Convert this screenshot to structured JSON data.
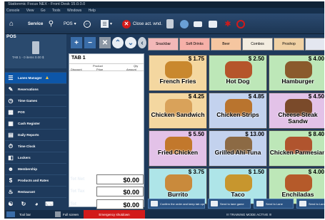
{
  "window": {
    "title": "Stationmic Focus NEX - Front Desk 15.0.0.0"
  },
  "menu": [
    "Console",
    "View",
    "Go",
    "Tools",
    "Windows",
    "Help"
  ],
  "toolbar": {
    "service_label": "Service",
    "pos_label": "POS",
    "close_act_label": "Close act. wnd."
  },
  "pos_panel": {
    "title": "POS",
    "subtitle": "TAB 1 - 0 items 0.00 $"
  },
  "sidebar": {
    "items": [
      {
        "label": "Lanes Manager",
        "icon": "lanes-icon"
      },
      {
        "label": "Reservations",
        "icon": "reservations-icon"
      },
      {
        "label": "Time Games",
        "icon": "clock-icon"
      },
      {
        "label": "POS",
        "icon": "pos-icon"
      },
      {
        "label": "Cash Register",
        "icon": "cash-register-icon"
      },
      {
        "label": "Daily Reports",
        "icon": "reports-icon"
      },
      {
        "label": "Time Clock",
        "icon": "time-clock-icon"
      },
      {
        "label": "Lockers",
        "icon": "lockers-icon"
      },
      {
        "label": "Membership",
        "icon": "membership-icon"
      },
      {
        "label": "Products and Rates",
        "icon": "products-icon"
      },
      {
        "label": "Restaurant",
        "icon": "restaurant-icon"
      }
    ]
  },
  "ticket": {
    "tab_name": "TAB 1",
    "columns": {
      "product": "Product",
      "qty": "Qty",
      "discount": "Discount",
      "price": "Price",
      "amount": "Amount"
    },
    "tot_net_label": "Tot Net",
    "tot_net": "$0.00",
    "tot_tax_label": "Tot Tax",
    "tot_tax": "$0.00",
    "tot_label": "Tot",
    "tot": "$0.00"
  },
  "categories": [
    {
      "label": "Snackbar",
      "color": "#f3b8b8"
    },
    {
      "label": "Soft Drinks",
      "color": "#f6b0a8"
    },
    {
      "label": "Beer",
      "color": "#f5c6a0"
    },
    {
      "label": "Combos",
      "color": "#f3ede0"
    },
    {
      "label": "Proshop",
      "color": "#f0d1a4"
    },
    {
      "label": "",
      "color": "#e4e7f0"
    }
  ],
  "products": [
    {
      "name": "French Fries",
      "price": "$ 1.75",
      "color": "#f4d7a0"
    },
    {
      "name": "Hot Dog",
      "price": "$ 2.50",
      "color": "#bde7b8"
    },
    {
      "name": "Hamburger",
      "price": "$ 4.00",
      "color": "#bde7b8"
    },
    {
      "name": "Chicken Sandwich",
      "price": "$ 4.25",
      "color": "#f4d7a0"
    },
    {
      "name": "Chicken Strips",
      "price": "$ 4.85",
      "color": "#c3d2ee"
    },
    {
      "name": "Cheese Steak Sandw",
      "price": "$ 4.50",
      "color": "#e3c2e8"
    },
    {
      "name": "Fried Chicken",
      "price": "$ 5.50",
      "color": "#e3c2e8"
    },
    {
      "name": "Grilled Ahi Tuna",
      "price": "$ 13.00",
      "color": "#c3d2ee"
    },
    {
      "name": "Chicken Parmesian",
      "price": "$ 8.40",
      "color": "#bde7b8"
    },
    {
      "name": "Burrito",
      "price": "$ 3.75",
      "color": "#aee5e8"
    },
    {
      "name": "Taco",
      "price": "$ 1.50",
      "color": "#aee5e8"
    },
    {
      "name": "Enchiladas",
      "price": "$ 4.00",
      "color": "#bde7b8"
    }
  ],
  "actions": [
    {
      "label": "Confirm the order and keep tab open"
    },
    {
      "label": "Send to lane game"
    },
    {
      "label": "Send to Lane"
    },
    {
      "label": "Send to Lane"
    }
  ],
  "bottom": {
    "tool_bar": "Tool bar",
    "full_screen": "Full screen",
    "emergency": "Emergency shutdown",
    "training": "!!! TRAINING MODE ACTIVE !!!"
  },
  "colors": {
    "accent": "#0d56a8",
    "danger": "#d21a1a",
    "toolbar_bg": "#2b4a70"
  }
}
